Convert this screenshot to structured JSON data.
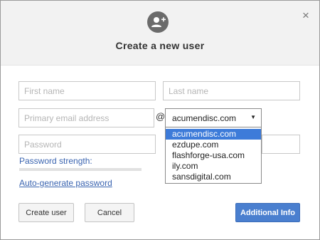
{
  "dialog": {
    "title": "Create a new user",
    "close_glyph": "×",
    "header_icon": "add-user-icon"
  },
  "form": {
    "first_name_placeholder": "First name",
    "last_name_placeholder": "Last name",
    "email_placeholder": "Primary email address",
    "at_symbol": "@",
    "password_placeholder": "Password",
    "password_strength_label": "Password strength:",
    "password_strength_value": 0,
    "auto_generate_label": "Auto-generate password"
  },
  "domain_select": {
    "selected": "acumendisc.com",
    "arrow": "▼",
    "options": [
      "acumendisc.com",
      "ezdupe.com",
      "flashforge-usa.com",
      "ily.com",
      "sansdigital.com"
    ],
    "highlighted_index": 0
  },
  "buttons": {
    "create": "Create user",
    "cancel": "Cancel",
    "additional": "Additional Info"
  },
  "colors": {
    "link": "#3a64b0",
    "primary": "#4a7fcf",
    "highlight": "#3d7bd9",
    "header_bg": "#f2f2f2"
  }
}
